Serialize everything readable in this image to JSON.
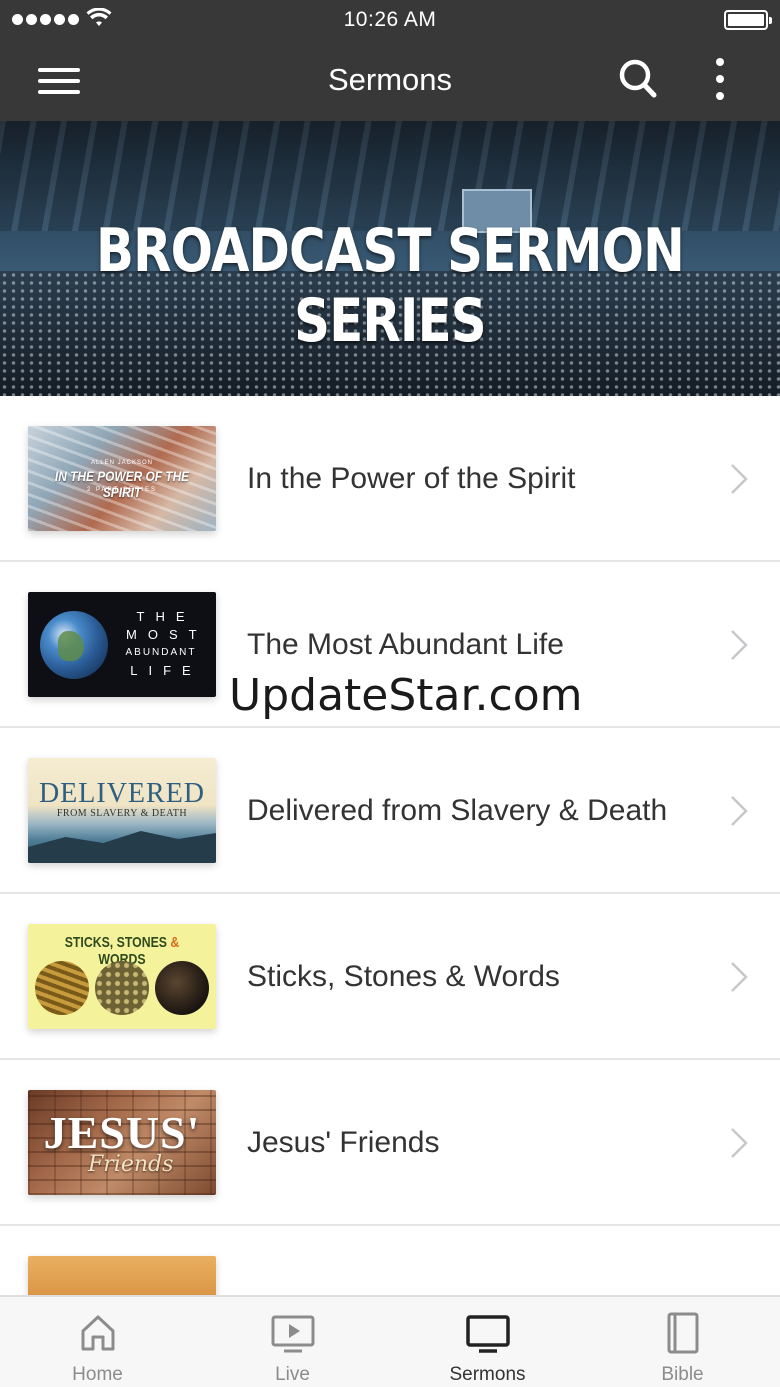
{
  "status_bar": {
    "time": "10:26 AM"
  },
  "app_bar": {
    "title": "Sermons"
  },
  "hero": {
    "title": "BROADCAST SERMON SERIES"
  },
  "sermons": [
    {
      "title": "In the Power of the Spirit",
      "thumb": {
        "line1": "ALLEN JACKSON",
        "line2": "IN THE POWER OF THE SPIRIT",
        "line3": "2 PART SERIES"
      }
    },
    {
      "title": "The Most Abundant Life",
      "thumb": {
        "line1": "THE",
        "line2": "MOST",
        "line3": "ABUNDANT",
        "line4": "LIFE"
      }
    },
    {
      "title": "Delivered from Slavery & Death",
      "thumb": {
        "line1": "DELIVERED",
        "line2": "FROM SLAVERY & DEATH"
      }
    },
    {
      "title": "Sticks, Stones & Words",
      "thumb": {
        "line1": "STICKS, STONES ",
        "amp": "&",
        "line2": " WORDS"
      }
    },
    {
      "title": "Jesus' Friends",
      "thumb": {
        "line1": "JESUS'",
        "line2": "Friends"
      }
    },
    {
      "title": ""
    }
  ],
  "watermark": "UpdateStar.com",
  "tabs": [
    {
      "label": "Home",
      "icon": "home-icon",
      "active": false
    },
    {
      "label": "Live",
      "icon": "play-screen-icon",
      "active": false
    },
    {
      "label": "Sermons",
      "icon": "tv-icon",
      "active": true
    },
    {
      "label": "Bible",
      "icon": "book-icon",
      "active": false
    }
  ],
  "colors": {
    "bar_background": "#383838",
    "tab_active": "#333333",
    "tab_inactive": "#8c8c8c"
  }
}
